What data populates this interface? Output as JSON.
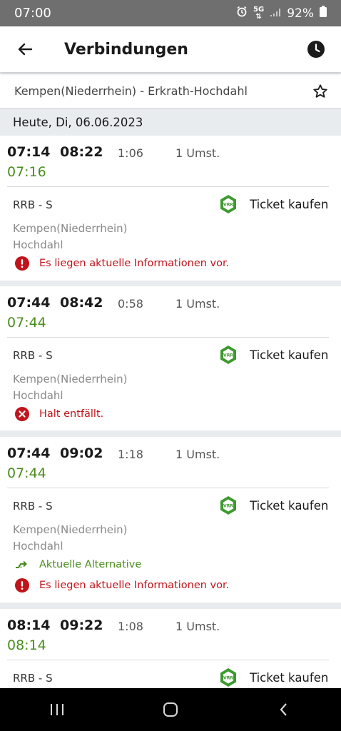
{
  "status_bar": {
    "time": "07:00",
    "network": "5G",
    "battery": "92%"
  },
  "header": {
    "title": "Verbindungen"
  },
  "route": {
    "text": "Kempen(Niederrhein) - Erkrath-Hochdahl"
  },
  "date": {
    "text": "Heute, Di, 06.06.2023"
  },
  "connections": [
    {
      "dep": "07:14",
      "arr": "08:22",
      "duration": "1:06",
      "changes": "1 Umst.",
      "realtime": "07:16",
      "line": "RRB - S",
      "ticket": "Ticket kaufen",
      "from": "Kempen(Niederrhein)",
      "to": "Hochdahl",
      "info": "Es liegen aktuelle Informationen vor."
    },
    {
      "dep": "07:44",
      "arr": "08:42",
      "duration": "0:58",
      "changes": "1 Umst.",
      "realtime": "07:44",
      "line": "RRB - S",
      "ticket": "Ticket kaufen",
      "from": "Kempen(Niederrhein)",
      "to": "Hochdahl",
      "info": "Halt entfällt."
    },
    {
      "dep": "07:44",
      "arr": "09:02",
      "duration": "1:18",
      "changes": "1 Umst.",
      "realtime": "07:44",
      "line": "RRB - S",
      "ticket": "Ticket kaufen",
      "from": "Kempen(Niederrhein)",
      "to": "Hochdahl",
      "alternative": "Aktuelle Alternative",
      "info": "Es liegen aktuelle Informationen vor."
    },
    {
      "dep": "08:14",
      "arr": "09:22",
      "duration": "1:08",
      "changes": "1 Umst.",
      "realtime": "08:14",
      "line": "RRB - S",
      "ticket": "Ticket kaufen"
    }
  ],
  "icons": {
    "vrr_logo_text": "VRR"
  },
  "colors": {
    "realtime_green": "#4a8c1c",
    "alert_red": "#c0141b",
    "vrr_green": "#3d9a2f"
  }
}
